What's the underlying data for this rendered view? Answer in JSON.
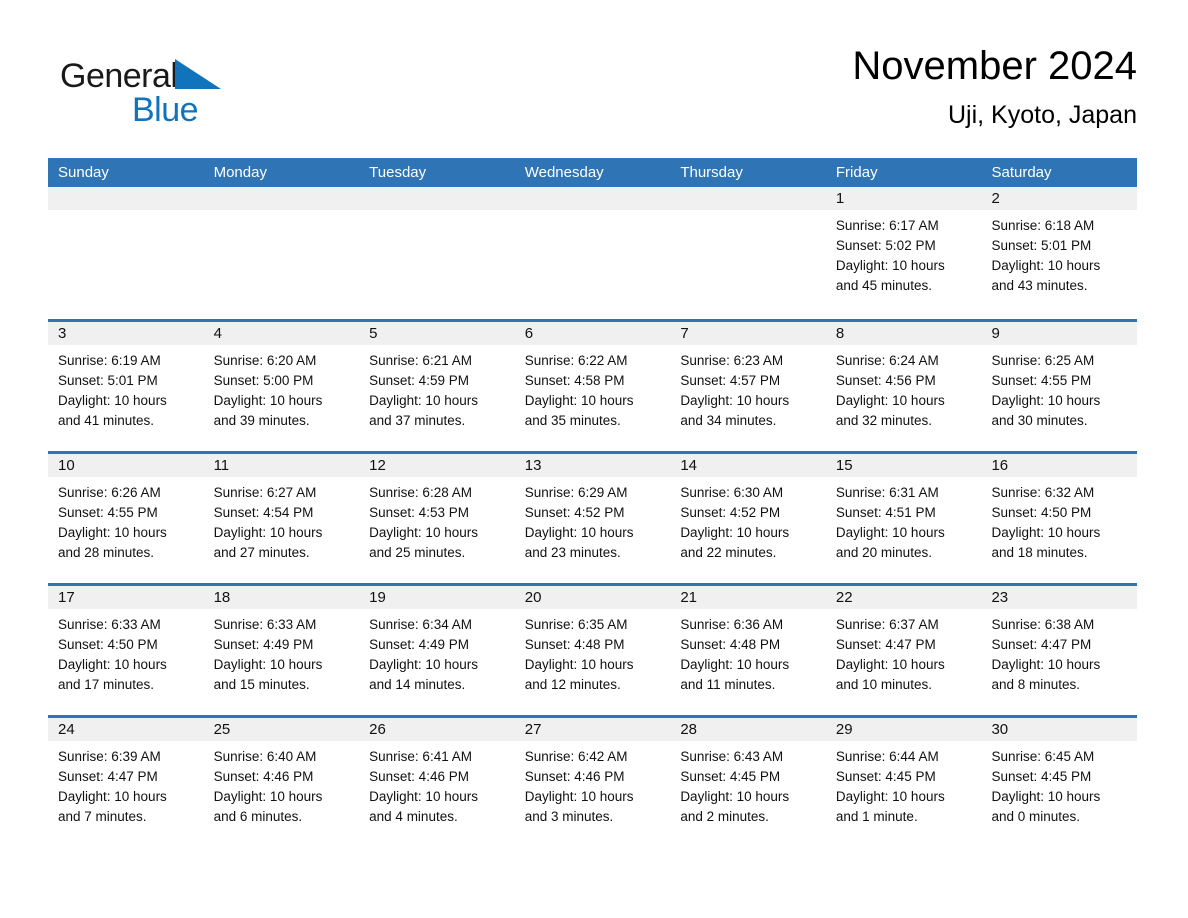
{
  "brand": {
    "name_part1": "General",
    "name_part2": "Blue",
    "triangle_color": "#1273bd",
    "text_color": "#1a1a1a"
  },
  "header": {
    "title": "November 2024",
    "location": "Uji, Kyoto, Japan"
  },
  "theme": {
    "header_blue": "#2f74b5",
    "band_gray": "#f0f0f0",
    "separator_blue": "#2f74b5",
    "page_background": "#ffffff"
  },
  "weekdays": [
    "Sunday",
    "Monday",
    "Tuesday",
    "Wednesday",
    "Thursday",
    "Friday",
    "Saturday"
  ],
  "weeks": [
    [
      {
        "day": "",
        "lines": []
      },
      {
        "day": "",
        "lines": []
      },
      {
        "day": "",
        "lines": []
      },
      {
        "day": "",
        "lines": []
      },
      {
        "day": "",
        "lines": []
      },
      {
        "day": "1",
        "lines": [
          "Sunrise: 6:17 AM",
          "Sunset: 5:02 PM",
          "Daylight: 10 hours",
          "and 45 minutes."
        ]
      },
      {
        "day": "2",
        "lines": [
          "Sunrise: 6:18 AM",
          "Sunset: 5:01 PM",
          "Daylight: 10 hours",
          "and 43 minutes."
        ]
      }
    ],
    [
      {
        "day": "3",
        "lines": [
          "Sunrise: 6:19 AM",
          "Sunset: 5:01 PM",
          "Daylight: 10 hours",
          "and 41 minutes."
        ]
      },
      {
        "day": "4",
        "lines": [
          "Sunrise: 6:20 AM",
          "Sunset: 5:00 PM",
          "Daylight: 10 hours",
          "and 39 minutes."
        ]
      },
      {
        "day": "5",
        "lines": [
          "Sunrise: 6:21 AM",
          "Sunset: 4:59 PM",
          "Daylight: 10 hours",
          "and 37 minutes."
        ]
      },
      {
        "day": "6",
        "lines": [
          "Sunrise: 6:22 AM",
          "Sunset: 4:58 PM",
          "Daylight: 10 hours",
          "and 35 minutes."
        ]
      },
      {
        "day": "7",
        "lines": [
          "Sunrise: 6:23 AM",
          "Sunset: 4:57 PM",
          "Daylight: 10 hours",
          "and 34 minutes."
        ]
      },
      {
        "day": "8",
        "lines": [
          "Sunrise: 6:24 AM",
          "Sunset: 4:56 PM",
          "Daylight: 10 hours",
          "and 32 minutes."
        ]
      },
      {
        "day": "9",
        "lines": [
          "Sunrise: 6:25 AM",
          "Sunset: 4:55 PM",
          "Daylight: 10 hours",
          "and 30 minutes."
        ]
      }
    ],
    [
      {
        "day": "10",
        "lines": [
          "Sunrise: 6:26 AM",
          "Sunset: 4:55 PM",
          "Daylight: 10 hours",
          "and 28 minutes."
        ]
      },
      {
        "day": "11",
        "lines": [
          "Sunrise: 6:27 AM",
          "Sunset: 4:54 PM",
          "Daylight: 10 hours",
          "and 27 minutes."
        ]
      },
      {
        "day": "12",
        "lines": [
          "Sunrise: 6:28 AM",
          "Sunset: 4:53 PM",
          "Daylight: 10 hours",
          "and 25 minutes."
        ]
      },
      {
        "day": "13",
        "lines": [
          "Sunrise: 6:29 AM",
          "Sunset: 4:52 PM",
          "Daylight: 10 hours",
          "and 23 minutes."
        ]
      },
      {
        "day": "14",
        "lines": [
          "Sunrise: 6:30 AM",
          "Sunset: 4:52 PM",
          "Daylight: 10 hours",
          "and 22 minutes."
        ]
      },
      {
        "day": "15",
        "lines": [
          "Sunrise: 6:31 AM",
          "Sunset: 4:51 PM",
          "Daylight: 10 hours",
          "and 20 minutes."
        ]
      },
      {
        "day": "16",
        "lines": [
          "Sunrise: 6:32 AM",
          "Sunset: 4:50 PM",
          "Daylight: 10 hours",
          "and 18 minutes."
        ]
      }
    ],
    [
      {
        "day": "17",
        "lines": [
          "Sunrise: 6:33 AM",
          "Sunset: 4:50 PM",
          "Daylight: 10 hours",
          "and 17 minutes."
        ]
      },
      {
        "day": "18",
        "lines": [
          "Sunrise: 6:33 AM",
          "Sunset: 4:49 PM",
          "Daylight: 10 hours",
          "and 15 minutes."
        ]
      },
      {
        "day": "19",
        "lines": [
          "Sunrise: 6:34 AM",
          "Sunset: 4:49 PM",
          "Daylight: 10 hours",
          "and 14 minutes."
        ]
      },
      {
        "day": "20",
        "lines": [
          "Sunrise: 6:35 AM",
          "Sunset: 4:48 PM",
          "Daylight: 10 hours",
          "and 12 minutes."
        ]
      },
      {
        "day": "21",
        "lines": [
          "Sunrise: 6:36 AM",
          "Sunset: 4:48 PM",
          "Daylight: 10 hours",
          "and 11 minutes."
        ]
      },
      {
        "day": "22",
        "lines": [
          "Sunrise: 6:37 AM",
          "Sunset: 4:47 PM",
          "Daylight: 10 hours",
          "and 10 minutes."
        ]
      },
      {
        "day": "23",
        "lines": [
          "Sunrise: 6:38 AM",
          "Sunset: 4:47 PM",
          "Daylight: 10 hours",
          "and 8 minutes."
        ]
      }
    ],
    [
      {
        "day": "24",
        "lines": [
          "Sunrise: 6:39 AM",
          "Sunset: 4:47 PM",
          "Daylight: 10 hours",
          "and 7 minutes."
        ]
      },
      {
        "day": "25",
        "lines": [
          "Sunrise: 6:40 AM",
          "Sunset: 4:46 PM",
          "Daylight: 10 hours",
          "and 6 minutes."
        ]
      },
      {
        "day": "26",
        "lines": [
          "Sunrise: 6:41 AM",
          "Sunset: 4:46 PM",
          "Daylight: 10 hours",
          "and 4 minutes."
        ]
      },
      {
        "day": "27",
        "lines": [
          "Sunrise: 6:42 AM",
          "Sunset: 4:46 PM",
          "Daylight: 10 hours",
          "and 3 minutes."
        ]
      },
      {
        "day": "28",
        "lines": [
          "Sunrise: 6:43 AM",
          "Sunset: 4:45 PM",
          "Daylight: 10 hours",
          "and 2 minutes."
        ]
      },
      {
        "day": "29",
        "lines": [
          "Sunrise: 6:44 AM",
          "Sunset: 4:45 PM",
          "Daylight: 10 hours",
          "and 1 minute."
        ]
      },
      {
        "day": "30",
        "lines": [
          "Sunrise: 6:45 AM",
          "Sunset: 4:45 PM",
          "Daylight: 10 hours",
          "and 0 minutes."
        ]
      }
    ]
  ]
}
